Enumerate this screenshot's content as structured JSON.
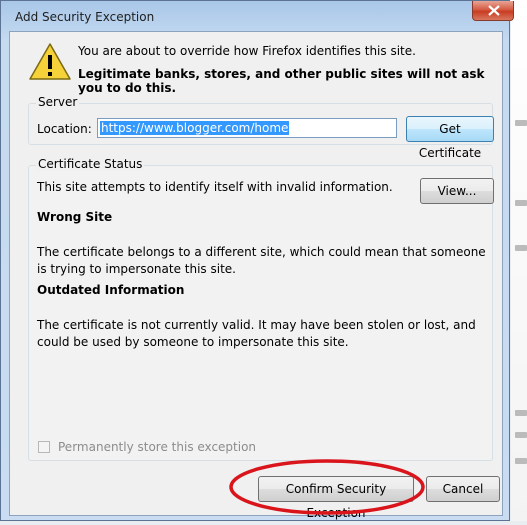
{
  "window": {
    "title": "Add Security Exception"
  },
  "warning": {
    "line1": "You are about to override how Firefox identifies this site.",
    "line2": "Legitimate banks, stores, and other public sites will not ask you to do this."
  },
  "server": {
    "group_label": "Server",
    "location_label": "Location:",
    "location_value": "https://www.blogger.com/home",
    "get_certificate_label": "Get Certificate"
  },
  "certificate_status": {
    "group_label": "Certificate Status",
    "summary": "This site attempts to identify itself with invalid information.",
    "view_label": "View...",
    "wrong_site_heading": "Wrong Site",
    "wrong_site_text": "The certificate belongs to a different site, which could mean that someone is trying to impersonate this site.",
    "outdated_heading": "Outdated Information",
    "outdated_text": "The certificate is not currently valid. It may have been stolen or lost, and could be used by someone to impersonate this site."
  },
  "permanent_store": {
    "label": "Permanently store this exception",
    "checked": false,
    "enabled": false
  },
  "buttons": {
    "confirm_label": "Confirm Security Exception",
    "cancel_label": "Cancel"
  },
  "colors": {
    "annotation_circle": "#d9141b",
    "selection": "#3399ff"
  }
}
